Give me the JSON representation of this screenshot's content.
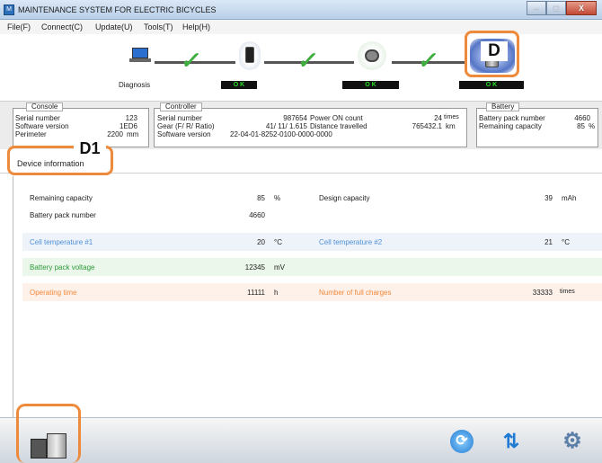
{
  "window": {
    "title": "MAINTENANCE SYSTEM FOR ELECTRIC BICYCLES",
    "minimize": "–",
    "maximize": "□",
    "close": "X"
  },
  "menu": [
    "File(F)",
    "Connect(C)",
    "Update(U)",
    "Tools(T)",
    "Help(H)"
  ],
  "diagnosis": {
    "label": "Diagnosis",
    "devices": [
      "laptop-icon",
      "controller-icon",
      "motor-icon",
      "battery-icon"
    ],
    "status": [
      "O K",
      "O K",
      "O K"
    ]
  },
  "markers": {
    "d": "D",
    "d1": "D1"
  },
  "console": {
    "title": "Console",
    "serial_label": "Serial number",
    "serial": "123",
    "software_label": "Software version",
    "software": "1ED6",
    "perimeter_label": "Perimeter",
    "perimeter": "2200",
    "perimeter_unit": "mm"
  },
  "controller": {
    "title": "Controller",
    "serial_label": "Serial number",
    "serial": "987654",
    "gear_label": "Gear (F/ R/ Ratio)",
    "gear": "41/ 11/ 1.615",
    "software_label": "Software version",
    "software": "22-04-01-8252-0100-0000-0000",
    "power_on_label": "Power ON count",
    "power_on": "24",
    "power_on_unit": "times",
    "distance_label": "Distance travelled",
    "distance": "765432.1",
    "distance_unit": "km"
  },
  "battery": {
    "title": "Battery",
    "pack_label": "Battery pack number",
    "pack": "4660",
    "capacity_label": "Remaining capacity",
    "capacity": "85",
    "capacity_unit": "%"
  },
  "tab": {
    "label": "Device information"
  },
  "details": {
    "rows": [
      {
        "l1": "Remaining capacity",
        "v1": "85",
        "u1": "%",
        "l2": "Design capacity",
        "v2": "39",
        "u2": "mAh"
      },
      {
        "l1": "Battery pack number",
        "v1": "4660",
        "u1": "",
        "l2": "",
        "v2": "",
        "u2": ""
      },
      {
        "l1": "Cell temperature #1",
        "v1": "20",
        "u1": "°C",
        "l2": "Cell temperature #2",
        "v2": "21",
        "u2": "°C"
      },
      {
        "l1": "Battery pack voltage",
        "v1": "12345",
        "u1": "mV",
        "l2": "",
        "v2": "",
        "u2": ""
      },
      {
        "l1": "Operating time",
        "v1": "11111",
        "u1": "h",
        "l2": "Number of full charges",
        "v2": "33333",
        "u2": "times"
      }
    ]
  },
  "colors": {
    "accent_orange": "#ee8a3c",
    "temp_blue": "#4f8fd6",
    "voltage_green": "#2e9a3a",
    "time_orange": "#f3893a",
    "ok_green": "#27e027"
  },
  "bottom_icons": [
    "battery-device-icon",
    "globe-refresh-icon",
    "sync-icon",
    "settings-gear-icon"
  ]
}
